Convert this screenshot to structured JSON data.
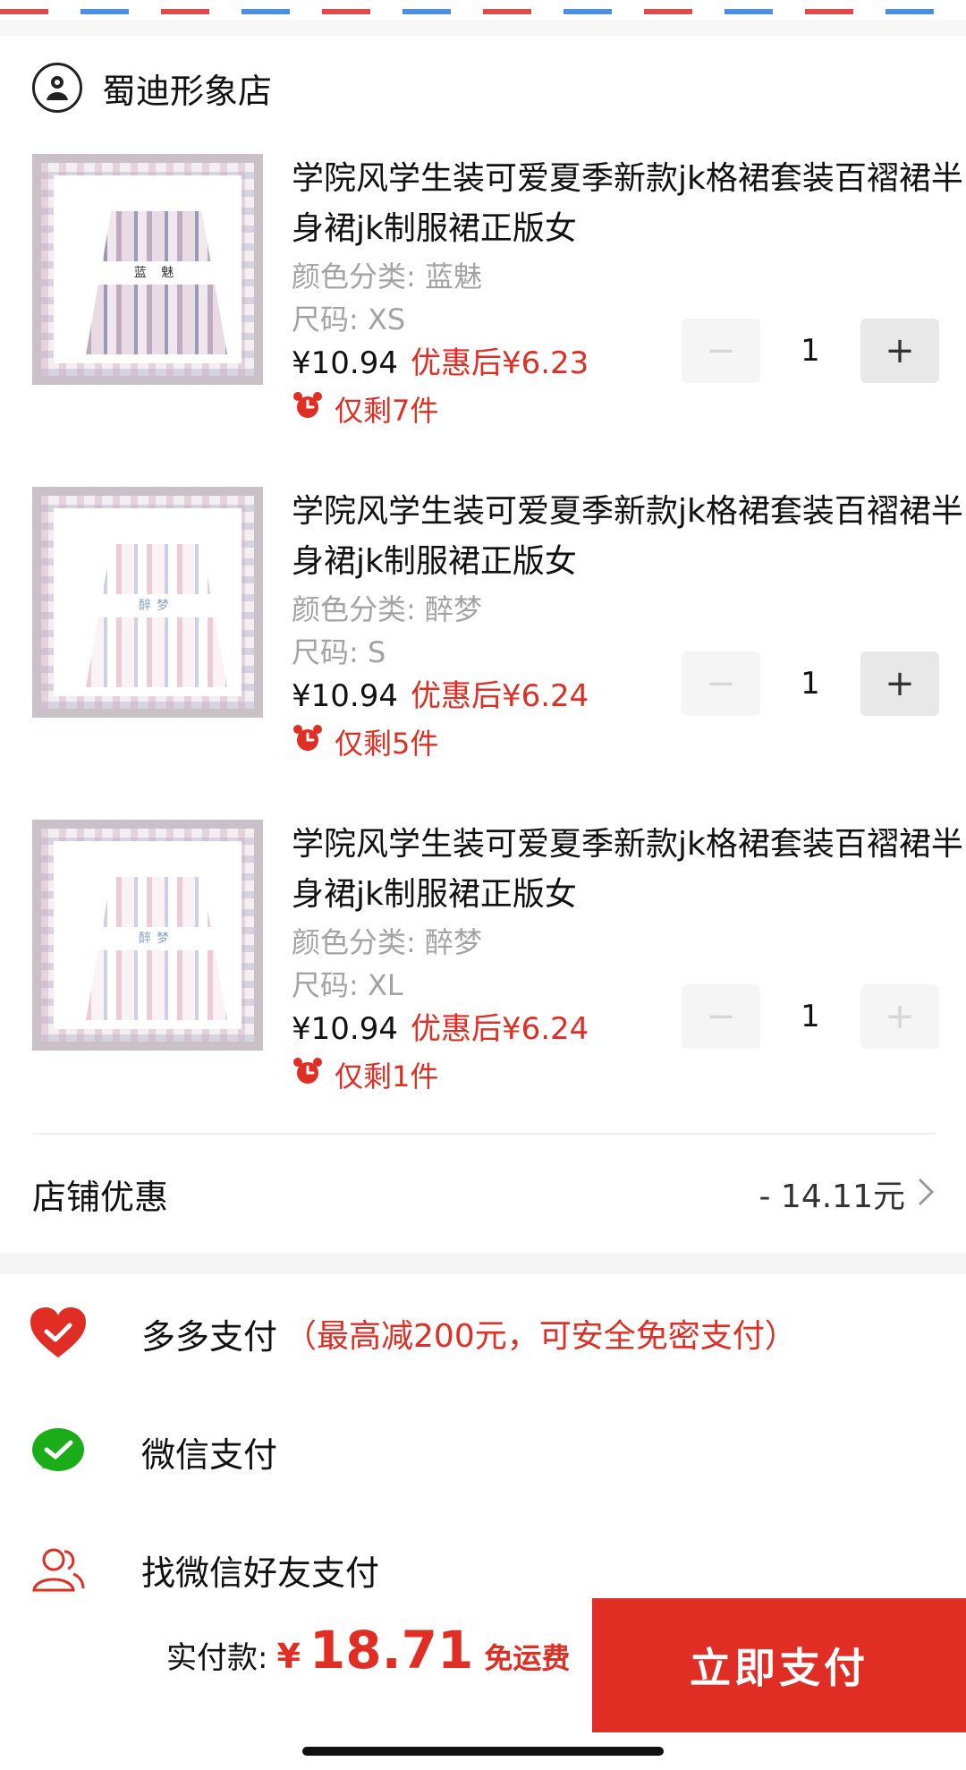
{
  "shop": {
    "name": "蜀迪形象店",
    "logo_icon": "shop-avatar-icon"
  },
  "items": [
    {
      "title": "学院风学生装可爱夏季新款jk格裙套装百褶裙半身裙jk制服裙正版女",
      "color_label": "颜色分类: 蓝魅",
      "size_label": "尺码: XS",
      "price": "¥10.94",
      "after_price": "优惠后¥6.23",
      "stock": "仅剩7件",
      "quantity": "1",
      "image_label": "蓝  魅",
      "plus_enabled": true
    },
    {
      "title": "学院风学生装可爱夏季新款jk格裙套装百褶裙半身裙jk制服裙正版女",
      "color_label": "颜色分类: 醉梦",
      "size_label": "尺码: S",
      "price": "¥10.94",
      "after_price": "优惠后¥6.24",
      "stock": "仅剩5件",
      "quantity": "1",
      "image_label": "醉梦",
      "plus_enabled": true
    },
    {
      "title": "学院风学生装可爱夏季新款jk格裙套装百褶裙半身裙jk制服裙正版女",
      "color_label": "颜色分类: 醉梦",
      "size_label": "尺码: XL",
      "price": "¥10.94",
      "after_price": "优惠后¥6.24",
      "stock": "仅剩1件",
      "quantity": "1",
      "image_label": "醉梦",
      "plus_enabled": false
    }
  ],
  "stepper": {
    "minus": "−",
    "plus": "+"
  },
  "discount": {
    "label": "店铺优惠",
    "value": "- 14.11元"
  },
  "payment": {
    "duoduo": {
      "label": "多多支付",
      "note": "（最高减200元，可安全免密支付）"
    },
    "wechat": {
      "label": "微信支付"
    },
    "friend": {
      "label": "找微信好友支付"
    }
  },
  "footer": {
    "total_label": "实付款:",
    "currency": "¥",
    "total_amount": "18.71",
    "shipping": "免运费",
    "pay_button": "立即支付"
  },
  "colors": {
    "accent_red": "#e02e24",
    "wechat_green": "#1aad19"
  }
}
